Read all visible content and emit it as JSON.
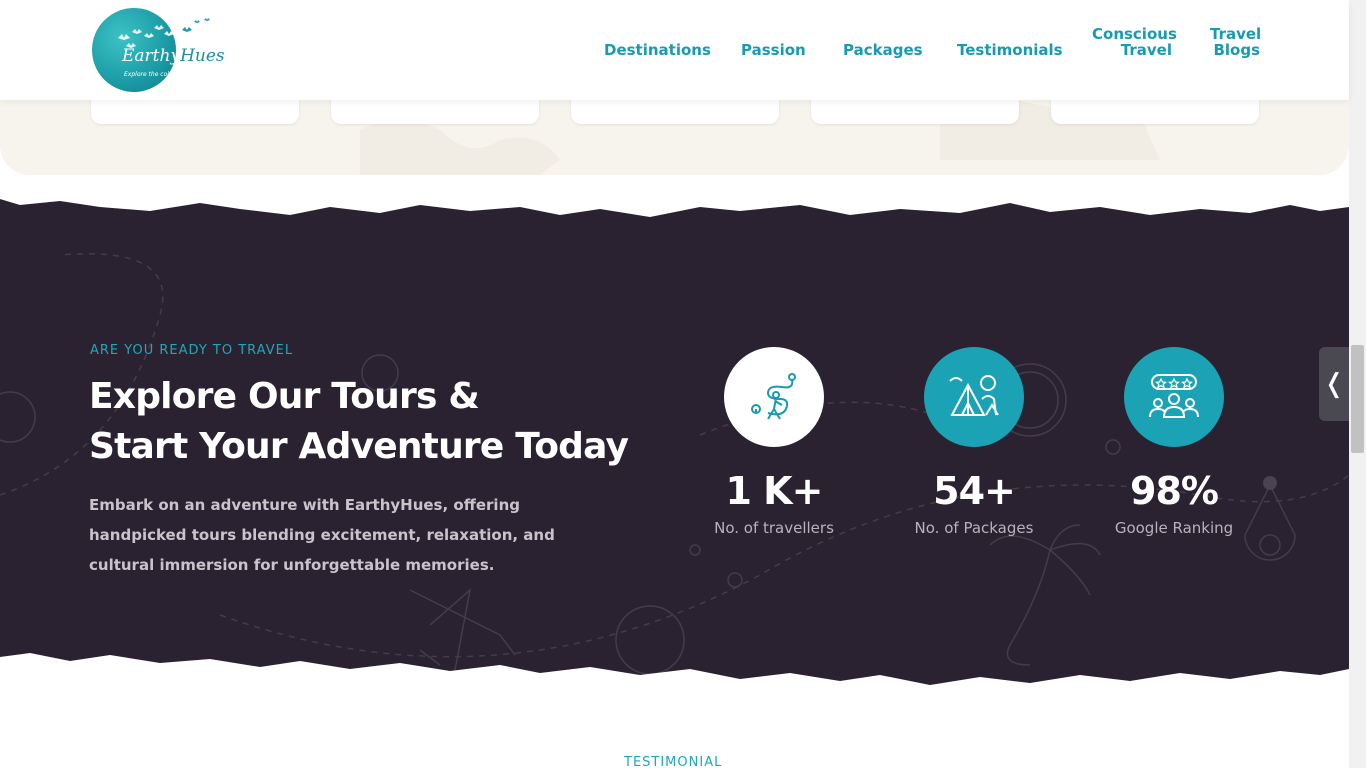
{
  "brand": {
    "logo_name_1": "Earthy",
    "logo_name_2": "Hues",
    "logo_tagline": "Explore the colours of nature"
  },
  "nav": {
    "items": [
      {
        "label": "Destinations"
      },
      {
        "label": "Passion"
      },
      {
        "label": "Packages"
      },
      {
        "label": "Testimonials"
      },
      {
        "label_line1": "Conscious",
        "label_line2": "Travel"
      },
      {
        "label_line1": "Travel",
        "label_line2": "Blogs"
      }
    ]
  },
  "hero": {
    "eyebrow": "ARE YOU READY TO TRAVEL",
    "headline_line1": "Explore Our Tours &",
    "headline_line2": "Start Your Adventure Today",
    "description": "Embark on an adventure with EarthyHues, offering handpicked tours blending excitement, relaxation, and cultural immersion for unforgettable memories."
  },
  "stats": [
    {
      "value": "1 K+",
      "label": "No. of travellers",
      "icon": "traveller-route-icon"
    },
    {
      "value": "54+",
      "label": "No. of Packages",
      "icon": "camping-tent-icon"
    },
    {
      "value": "98%",
      "label": "Google Ranking",
      "icon": "rating-group-icon"
    }
  ],
  "side_tab": {
    "glyph": "❬"
  },
  "next_section": {
    "eyebrow": "TESTIMONIAL"
  },
  "colors": {
    "accent": "#1a9ab0",
    "dark_bg": "#2a2230",
    "cream_bg": "#f7f4ee"
  }
}
